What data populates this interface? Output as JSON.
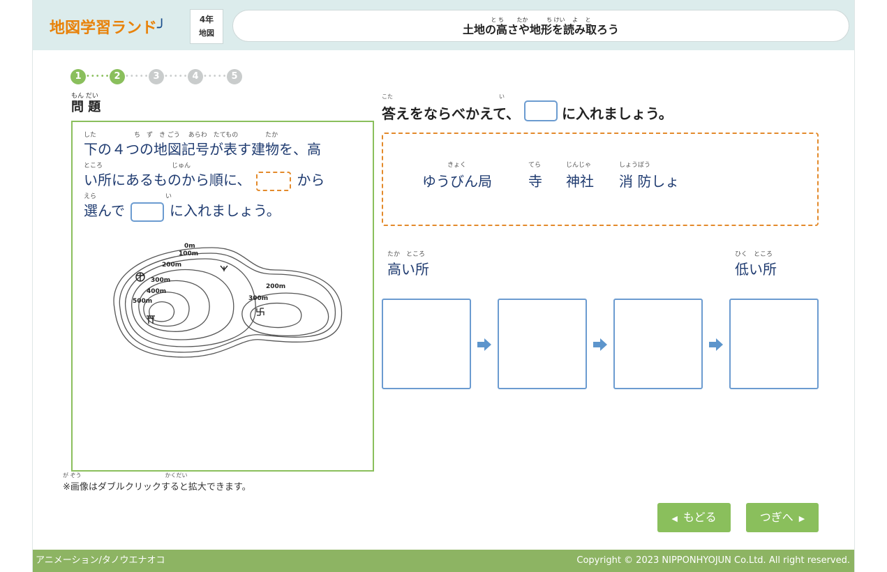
{
  "header": {
    "logo": "地図学習ランド",
    "grade": "4年",
    "subject": "地図",
    "title_ruby": "と ち　　 たか　　　 ち けい　 よ　 と",
    "title": "土地の高さや地形を読み取ろう"
  },
  "steps": [
    "1",
    "2",
    "3",
    "4",
    "5"
  ],
  "steps_done": 2,
  "problem": {
    "label_ruby": "もん だい",
    "label": "問 題",
    "line1_ruby": "した　　　　　　ち　ず　き ごう　 あらわ　たてもの　　　　 たか",
    "line1": "下の４つの地図記号が表す建物を、高",
    "line2_ruby": "ところ　　　　　　　　　　　じゅん",
    "line2a": "い所にあるものから順に、",
    "line2b": "から",
    "line3_ruby": "えら　　　　　　　　　　　い",
    "line3a": "選んで",
    "line3b": "に入れましょう。",
    "note_ruby": "が ぞう　　　　　　　　　　　　　　　かくだい",
    "note": "※画像はダブルクリックすると拡大できます。"
  },
  "map": {
    "labels": [
      "0m",
      "100m",
      "200m",
      "300m",
      "400m",
      "500m",
      "200m",
      "300m"
    ],
    "symbols": [
      "post-office",
      "torii",
      "temple",
      "fire-station"
    ]
  },
  "answer": {
    "label_ruby": "こた　　　　　　　　　　　　　　　　　　　い",
    "label_a": "答えをならべかえて、",
    "label_b": "に入れましょう。"
  },
  "choices": [
    {
      "ruby": "　　　　きょく",
      "text": "ゆうびん局"
    },
    {
      "ruby": "てら",
      "text": "寺"
    },
    {
      "ruby": "じんじゃ",
      "text": "神社"
    },
    {
      "ruby": "しょうぼう",
      "text": "消 防しょ"
    }
  ],
  "order": {
    "high_ruby": "たか　ところ",
    "high": "高い所",
    "low_ruby": "ひく　ところ",
    "low": "低い所"
  },
  "nav": {
    "back": "もどる",
    "next": "つぎへ"
  },
  "footer": {
    "credit": "アニメーション/タノウエナオコ",
    "copyright": "Copyright © 2023 NIPPONHYOJUN Co.Ltd. All right reserved."
  },
  "colors": {
    "accent_green": "#8abf5c",
    "header_bg": "#dcecec",
    "dashed_orange": "#e38a2b",
    "slot_blue": "#6b9bd0",
    "text_navy": "#1f3b70"
  }
}
